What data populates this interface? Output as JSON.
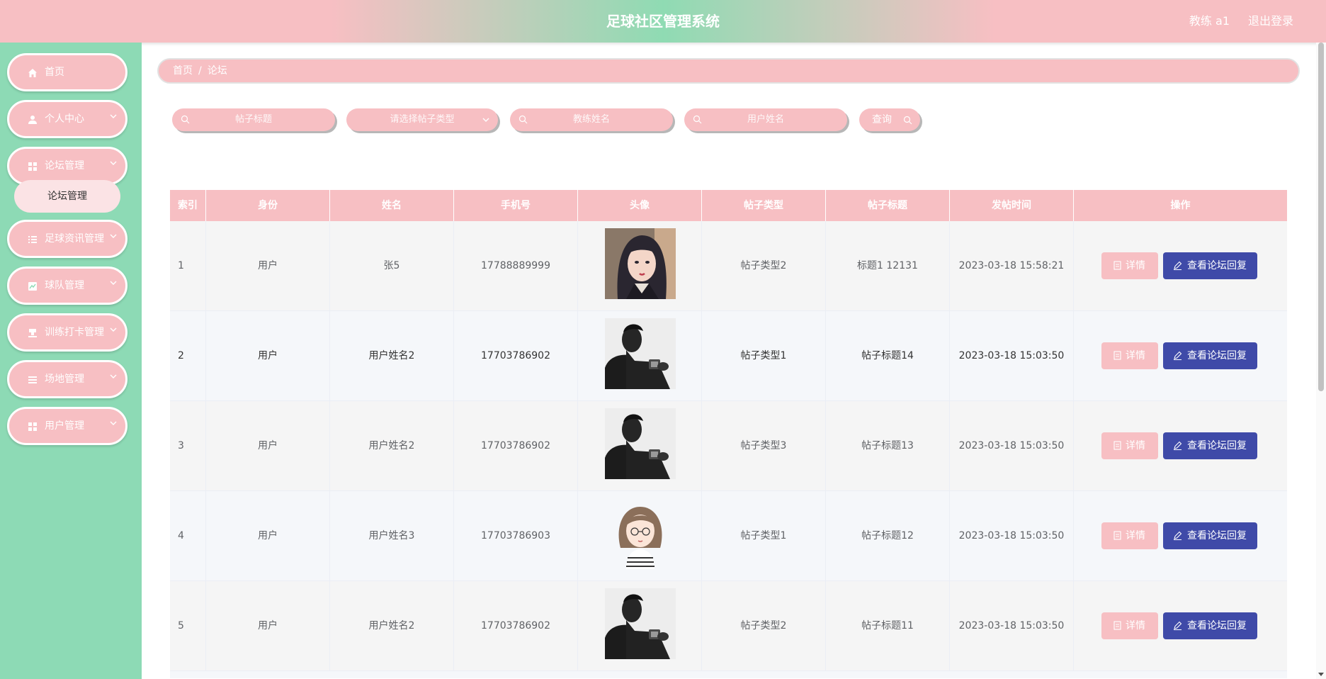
{
  "header": {
    "title": "足球社区管理系统",
    "user": "教练 a1",
    "logout": "退出登录"
  },
  "sidebar": {
    "items": [
      {
        "label": "首页",
        "icon": "home-icon",
        "has_children": false
      },
      {
        "label": "个人中心",
        "icon": "user-icon",
        "has_children": true
      },
      {
        "label": "论坛管理",
        "icon": "grid-icon",
        "has_children": true
      },
      {
        "label": "足球资讯管理",
        "icon": "list-icon",
        "has_children": true
      },
      {
        "label": "球队管理",
        "icon": "chart-icon",
        "has_children": true
      },
      {
        "label": "训练打卡管理",
        "icon": "stamp-icon",
        "has_children": true
      },
      {
        "label": "场地管理",
        "icon": "menu-icon",
        "has_children": true
      },
      {
        "label": "用户管理",
        "icon": "grid-icon",
        "has_children": true
      }
    ],
    "active_sub": "论坛管理"
  },
  "breadcrumb": {
    "home": "首页",
    "separator": "/",
    "current": "论坛"
  },
  "search": {
    "title_placeholder": "帖子标题",
    "type_placeholder": "请选择帖子类型",
    "coach_placeholder": "教练姓名",
    "user_placeholder": "用户姓名",
    "query_label": "查询"
  },
  "table": {
    "columns": [
      "索引",
      "身份",
      "姓名",
      "手机号",
      "头像",
      "帖子类型",
      "帖子标题",
      "发帖时间",
      "操作"
    ],
    "detail_label": "详情",
    "reply_label": "查看论坛回复",
    "rows": [
      {
        "index": "1",
        "role": "用户",
        "name": "张5",
        "phone": "17788889999",
        "avatar": "girl-photo",
        "type": "帖子类型2",
        "title": "标题1 12131",
        "time": "2023-03-18 15:58:21"
      },
      {
        "index": "2",
        "role": "用户",
        "name": "用户姓名2",
        "phone": "17703786902",
        "avatar": "man-silhouette",
        "type": "帖子类型1",
        "title": "帖子标题14",
        "time": "2023-03-18 15:03:50"
      },
      {
        "index": "3",
        "role": "用户",
        "name": "用户姓名2",
        "phone": "17703786902",
        "avatar": "man-silhouette",
        "type": "帖子类型3",
        "title": "帖子标题13",
        "time": "2023-03-18 15:03:50"
      },
      {
        "index": "4",
        "role": "用户",
        "name": "用户姓名3",
        "phone": "17703786903",
        "avatar": "cartoon-girl",
        "type": "帖子类型1",
        "title": "帖子标题12",
        "time": "2023-03-18 15:03:50"
      },
      {
        "index": "5",
        "role": "用户",
        "name": "用户姓名2",
        "phone": "17703786902",
        "avatar": "man-silhouette",
        "type": "帖子类型2",
        "title": "帖子标题11",
        "time": "2023-03-18 15:03:50"
      }
    ]
  },
  "colors": {
    "pink": "#f7bfc3",
    "green": "#8ddab5",
    "reply_button": "#3f4aa8"
  }
}
